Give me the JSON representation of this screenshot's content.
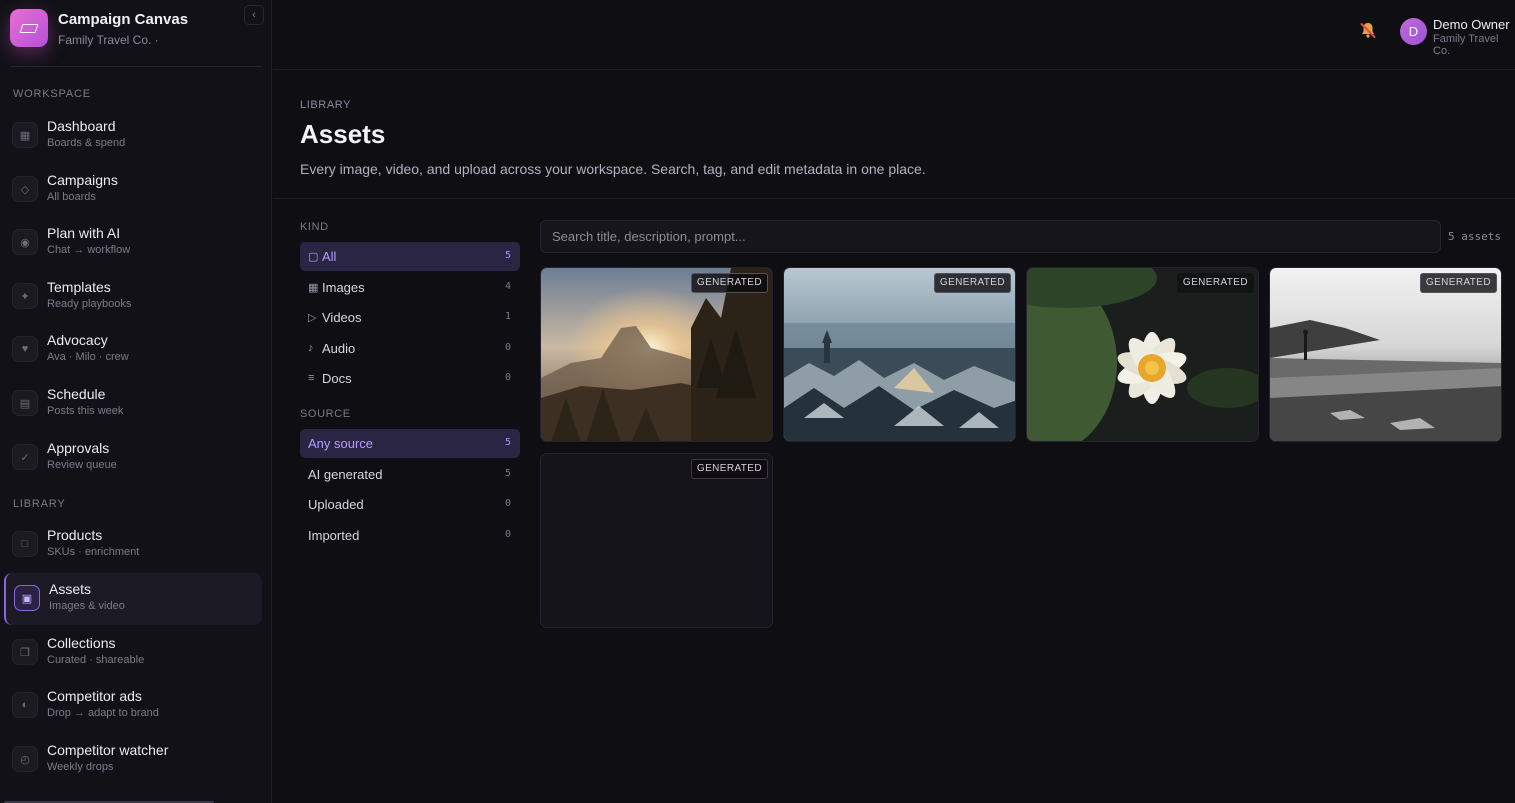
{
  "app": {
    "name": "Campaign Canvas",
    "org": "Family Travel Co. ·",
    "collapse_glyph": "‹"
  },
  "sidebar": {
    "workspace_label": "WORKSPACE",
    "library_label": "LIBRARY",
    "workspace_items": [
      {
        "title": "Dashboard",
        "sub": "Boards & spend",
        "icon": "grid-icon"
      },
      {
        "title": "Campaigns",
        "sub": "All boards",
        "icon": "diamond-icon"
      },
      {
        "title": "Plan with AI",
        "sub": "Chat → workflow",
        "icon": "sparkle-dot-icon"
      },
      {
        "title": "Templates",
        "sub": "Ready playbooks",
        "icon": "star-icon"
      },
      {
        "title": "Advocacy",
        "sub": "Ava · Milo · crew",
        "icon": "heart-icon"
      },
      {
        "title": "Schedule",
        "sub": "Posts this week",
        "icon": "calendar-icon"
      },
      {
        "title": "Approvals",
        "sub": "Review queue",
        "icon": "check-icon"
      }
    ],
    "library_items": [
      {
        "title": "Products",
        "sub": "SKUs · enrichment",
        "icon": "box-icon"
      },
      {
        "title": "Assets",
        "sub": "Images & video",
        "icon": "image-icon",
        "active": true
      },
      {
        "title": "Collections",
        "sub": "Curated · shareable",
        "icon": "stack-icon"
      },
      {
        "title": "Competitor ads",
        "sub": "Drop → adapt to brand",
        "icon": "half-circle-icon"
      },
      {
        "title": "Competitor watcher",
        "sub": "Weekly drops",
        "icon": "clock-icon"
      }
    ]
  },
  "topbar": {
    "user_initial": "D",
    "user_name": "Demo Owner",
    "user_org": "Family Travel Co."
  },
  "header": {
    "eyebrow": "LIBRARY",
    "title": "Assets",
    "description": "Every image, video, and upload across your workspace. Search, tag, and edit metadata in one place."
  },
  "filters": {
    "kind_label": "KIND",
    "source_label": "SOURCE",
    "kind": [
      {
        "name": "All",
        "count": "5",
        "glyph": "▢",
        "selected": true
      },
      {
        "name": "Images",
        "count": "4",
        "glyph": "▦"
      },
      {
        "name": "Videos",
        "count": "1",
        "glyph": "▷"
      },
      {
        "name": "Audio",
        "count": "0",
        "glyph": "♪"
      },
      {
        "name": "Docs",
        "count": "0",
        "glyph": "≡"
      }
    ],
    "source": [
      {
        "name": "Any source",
        "count": "5",
        "selected": true
      },
      {
        "name": "AI generated",
        "count": "5"
      },
      {
        "name": "Uploaded",
        "count": "0"
      },
      {
        "name": "Imported",
        "count": "0"
      }
    ]
  },
  "search": {
    "placeholder": "Search title, description, prompt...",
    "count_label": "5 assets"
  },
  "assets": [
    {
      "badge": "GENERATED",
      "scene": "mountain-sunset"
    },
    {
      "badge": "GENERATED",
      "scene": "snowy-city-rooftops"
    },
    {
      "badge": "GENERATED",
      "scene": "water-lily"
    },
    {
      "badge": "GENERATED",
      "scene": "foggy-beach-bw"
    },
    {
      "badge": "GENERATED",
      "scene": "empty"
    }
  ]
}
